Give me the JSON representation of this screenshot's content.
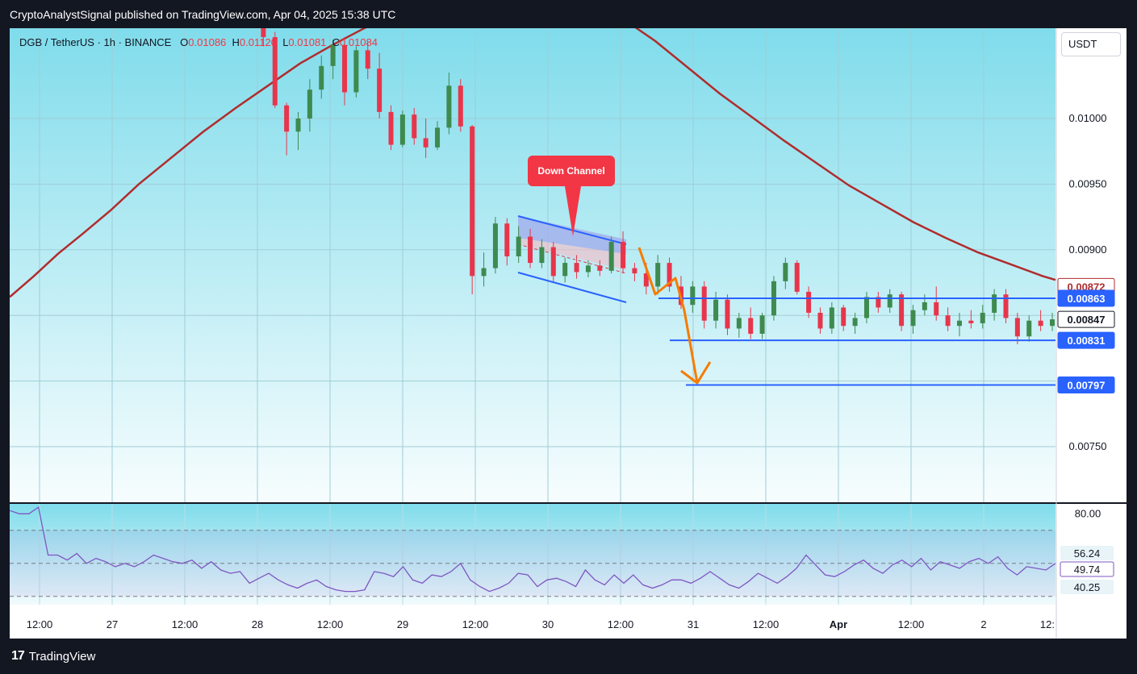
{
  "header": {
    "published_line": "CryptoAnalystSignal published on TradingView.com, Apr 04, 2025 15:38 UTC"
  },
  "legend": {
    "symbol": "DGB / TetherUS · 1h · BINANCE",
    "o_label": "O",
    "o_value": "0.01086",
    "h_label": "H",
    "h_value": "0.01120",
    "l_label": "L",
    "l_value": "0.01081",
    "c_label": "C",
    "c_value": "0.01084"
  },
  "currency_button": "USDT",
  "annotation": "Down Channel",
  "footer": {
    "logo_mark": "17",
    "logo_text": "TradingView"
  },
  "colors": {
    "bg_top": "#80dceb",
    "bg_bottom": "#ffffff",
    "up": "#3e8a4f",
    "down": "#e8354b",
    "ma": "#b02c2c",
    "level": "#2962ff",
    "arrow": "#f57c00",
    "rsi": "#7e57c2",
    "callout": "#f23645"
  },
  "chart_data": [
    {
      "type": "candlestick",
      "title": "DGB / TetherUS · 1h · BINANCE",
      "x_tick_labels": [
        "12:00",
        "27",
        "12:00",
        "28",
        "12:00",
        "29",
        "12:00",
        "30",
        "12:00",
        "31",
        "12:00",
        "Apr",
        "12:00",
        "2",
        "12:"
      ],
      "y_tick_labels": [
        "0.01000",
        "0.00950",
        "0.00900",
        "0.00750"
      ],
      "ylim": [
        0.0071,
        0.0108
      ],
      "grid": true,
      "ma_series": [
        [
          0,
          0.00864
        ],
        [
          30,
          0.0088
        ],
        [
          60,
          0.00897
        ],
        [
          90,
          0.00912
        ],
        [
          125,
          0.0093
        ],
        [
          160,
          0.0095
        ],
        [
          200,
          0.0097
        ],
        [
          240,
          0.0099
        ],
        [
          280,
          0.01008
        ],
        [
          320,
          0.01025
        ],
        [
          360,
          0.01042
        ],
        [
          400,
          0.01056
        ],
        [
          440,
          0.01069
        ],
        [
          480,
          0.01079
        ],
        [
          520,
          0.01087
        ],
        [
          560,
          0.01091
        ],
        [
          600,
          0.01094
        ],
        [
          640,
          0.01095
        ],
        [
          680,
          0.01092
        ],
        [
          720,
          0.01087
        ],
        [
          760,
          0.01076
        ],
        [
          800,
          0.01059
        ],
        [
          840,
          0.01039
        ],
        [
          880,
          0.01019
        ],
        [
          920,
          0.01001
        ],
        [
          960,
          0.00983
        ],
        [
          1000,
          0.00966
        ],
        [
          1040,
          0.00949
        ],
        [
          1080,
          0.00935
        ],
        [
          1120,
          0.00921
        ],
        [
          1160,
          0.00909
        ],
        [
          1200,
          0.00898
        ],
        [
          1240,
          0.00889
        ],
        [
          1280,
          0.0088
        ],
        [
          1296,
          0.00877
        ]
      ],
      "candles": [
        {
          "o": 0.01086,
          "h": 0.0112,
          "l": 0.01081,
          "c": 0.01084
        },
        {
          "o": 0.01084,
          "h": 0.01092,
          "l": 0.01055,
          "c": 0.01062
        },
        {
          "o": 0.01062,
          "h": 0.01066,
          "l": 0.01008,
          "c": 0.0101
        },
        {
          "o": 0.0101,
          "h": 0.01012,
          "l": 0.00972,
          "c": 0.0099
        },
        {
          "o": 0.0099,
          "h": 0.01005,
          "l": 0.00976,
          "c": 0.01
        },
        {
          "o": 0.01,
          "h": 0.0103,
          "l": 0.0099,
          "c": 0.01022
        },
        {
          "o": 0.01022,
          "h": 0.01048,
          "l": 0.01015,
          "c": 0.0104
        },
        {
          "o": 0.0104,
          "h": 0.0106,
          "l": 0.0103,
          "c": 0.01056
        },
        {
          "o": 0.01056,
          "h": 0.01062,
          "l": 0.0101,
          "c": 0.0102
        },
        {
          "o": 0.0102,
          "h": 0.01055,
          "l": 0.01016,
          "c": 0.01052
        },
        {
          "o": 0.01052,
          "h": 0.01058,
          "l": 0.0103,
          "c": 0.01038
        },
        {
          "o": 0.01038,
          "h": 0.0105,
          "l": 0.01,
          "c": 0.01005
        },
        {
          "o": 0.01005,
          "h": 0.0101,
          "l": 0.00976,
          "c": 0.0098
        },
        {
          "o": 0.0098,
          "h": 0.01006,
          "l": 0.00978,
          "c": 0.01003
        },
        {
          "o": 0.01003,
          "h": 0.01008,
          "l": 0.0098,
          "c": 0.00985
        },
        {
          "o": 0.00985,
          "h": 0.01,
          "l": 0.0097,
          "c": 0.00978
        },
        {
          "o": 0.00978,
          "h": 0.00998,
          "l": 0.00976,
          "c": 0.00993
        },
        {
          "o": 0.00993,
          "h": 0.01035,
          "l": 0.00988,
          "c": 0.01025
        },
        {
          "o": 0.01025,
          "h": 0.0103,
          "l": 0.0099,
          "c": 0.00994
        },
        {
          "o": 0.00994,
          "h": 0.00995,
          "l": 0.00866,
          "c": 0.0088
        },
        {
          "o": 0.0088,
          "h": 0.00898,
          "l": 0.00872,
          "c": 0.00886
        },
        {
          "o": 0.00886,
          "h": 0.00925,
          "l": 0.00882,
          "c": 0.0092
        },
        {
          "o": 0.0092,
          "h": 0.00924,
          "l": 0.00888,
          "c": 0.00895
        },
        {
          "o": 0.00895,
          "h": 0.00918,
          "l": 0.0089,
          "c": 0.0091
        },
        {
          "o": 0.0091,
          "h": 0.00916,
          "l": 0.00886,
          "c": 0.0089
        },
        {
          "o": 0.0089,
          "h": 0.00908,
          "l": 0.00886,
          "c": 0.00902
        },
        {
          "o": 0.00902,
          "h": 0.00906,
          "l": 0.00876,
          "c": 0.0088
        },
        {
          "o": 0.0088,
          "h": 0.00894,
          "l": 0.00875,
          "c": 0.0089
        },
        {
          "o": 0.0089,
          "h": 0.00896,
          "l": 0.00878,
          "c": 0.00883
        },
        {
          "o": 0.00883,
          "h": 0.00892,
          "l": 0.00879,
          "c": 0.00888
        },
        {
          "o": 0.00888,
          "h": 0.00892,
          "l": 0.0088,
          "c": 0.00884
        },
        {
          "o": 0.00884,
          "h": 0.0091,
          "l": 0.00882,
          "c": 0.00906
        },
        {
          "o": 0.00906,
          "h": 0.00914,
          "l": 0.00882,
          "c": 0.00886
        },
        {
          "o": 0.00886,
          "h": 0.0089,
          "l": 0.00876,
          "c": 0.00882
        },
        {
          "o": 0.00882,
          "h": 0.0089,
          "l": 0.00866,
          "c": 0.00872
        },
        {
          "o": 0.00872,
          "h": 0.00896,
          "l": 0.00866,
          "c": 0.0089
        },
        {
          "o": 0.0089,
          "h": 0.00894,
          "l": 0.00868,
          "c": 0.00872
        },
        {
          "o": 0.00872,
          "h": 0.0088,
          "l": 0.00855,
          "c": 0.00858
        },
        {
          "o": 0.00858,
          "h": 0.00876,
          "l": 0.00852,
          "c": 0.00872
        },
        {
          "o": 0.00872,
          "h": 0.00876,
          "l": 0.0084,
          "c": 0.00846
        },
        {
          "o": 0.00846,
          "h": 0.00868,
          "l": 0.0084,
          "c": 0.00862
        },
        {
          "o": 0.00862,
          "h": 0.00866,
          "l": 0.00835,
          "c": 0.0084
        },
        {
          "o": 0.0084,
          "h": 0.00852,
          "l": 0.00833,
          "c": 0.00848
        },
        {
          "o": 0.00848,
          "h": 0.00856,
          "l": 0.00832,
          "c": 0.00836
        },
        {
          "o": 0.00836,
          "h": 0.00852,
          "l": 0.00832,
          "c": 0.0085
        },
        {
          "o": 0.0085,
          "h": 0.0088,
          "l": 0.00846,
          "c": 0.00876
        },
        {
          "o": 0.00876,
          "h": 0.00894,
          "l": 0.0087,
          "c": 0.0089
        },
        {
          "o": 0.0089,
          "h": 0.00892,
          "l": 0.00866,
          "c": 0.00868
        },
        {
          "o": 0.00868,
          "h": 0.00872,
          "l": 0.00848,
          "c": 0.00852
        },
        {
          "o": 0.00852,
          "h": 0.00856,
          "l": 0.00836,
          "c": 0.0084
        },
        {
          "o": 0.0084,
          "h": 0.0086,
          "l": 0.00836,
          "c": 0.00856
        },
        {
          "o": 0.00856,
          "h": 0.00858,
          "l": 0.00838,
          "c": 0.00842
        },
        {
          "o": 0.00842,
          "h": 0.00852,
          "l": 0.00836,
          "c": 0.00848
        },
        {
          "o": 0.00848,
          "h": 0.00868,
          "l": 0.00844,
          "c": 0.00864
        },
        {
          "o": 0.00864,
          "h": 0.00868,
          "l": 0.00852,
          "c": 0.00856
        },
        {
          "o": 0.00856,
          "h": 0.0087,
          "l": 0.00852,
          "c": 0.00866
        },
        {
          "o": 0.00866,
          "h": 0.00868,
          "l": 0.00838,
          "c": 0.00842
        },
        {
          "o": 0.00842,
          "h": 0.00858,
          "l": 0.00836,
          "c": 0.00854
        },
        {
          "o": 0.00854,
          "h": 0.00866,
          "l": 0.0085,
          "c": 0.0086
        },
        {
          "o": 0.0086,
          "h": 0.00872,
          "l": 0.00846,
          "c": 0.0085
        },
        {
          "o": 0.0085,
          "h": 0.00856,
          "l": 0.00838,
          "c": 0.00842
        },
        {
          "o": 0.00842,
          "h": 0.00852,
          "l": 0.00834,
          "c": 0.00846
        },
        {
          "o": 0.00846,
          "h": 0.00854,
          "l": 0.0084,
          "c": 0.00844
        },
        {
          "o": 0.00844,
          "h": 0.00858,
          "l": 0.0084,
          "c": 0.00852
        },
        {
          "o": 0.00852,
          "h": 0.0087,
          "l": 0.00846,
          "c": 0.00866
        },
        {
          "o": 0.00866,
          "h": 0.0087,
          "l": 0.00844,
          "c": 0.00848
        },
        {
          "o": 0.00848,
          "h": 0.00852,
          "l": 0.00828,
          "c": 0.00834
        },
        {
          "o": 0.00834,
          "h": 0.0085,
          "l": 0.0083,
          "c": 0.00846
        },
        {
          "o": 0.00846,
          "h": 0.00854,
          "l": 0.00838,
          "c": 0.00842
        },
        {
          "o": 0.00842,
          "h": 0.00852,
          "l": 0.00838,
          "c": 0.00847
        }
      ],
      "levels": [
        {
          "label": "0.00872",
          "value": 0.00872,
          "tag_bg": "#ffffff",
          "tag_fg": "#b02c2c",
          "line": false
        },
        {
          "label": "0.00863",
          "value": 0.00863,
          "tag_bg": "#2962ff",
          "tag_fg": "#ffffff",
          "line": true
        },
        {
          "label": "0.00847",
          "value": 0.00847,
          "tag_bg": "#ffffff",
          "tag_fg": "#131722",
          "line": false
        },
        {
          "label": "0.00831",
          "value": 0.00831,
          "tag_bg": "#2962ff",
          "tag_fg": "#ffffff",
          "line": true
        },
        {
          "label": "0.00797",
          "value": 0.00797,
          "tag_bg": "#2962ff",
          "tag_fg": "#ffffff",
          "line": true
        }
      ]
    },
    {
      "type": "line",
      "title": "RSI",
      "ylim": [
        25,
        86
      ],
      "y_tick_labels": [
        "80.00"
      ],
      "bands": [
        70,
        50,
        30
      ],
      "value_tags": [
        "56.24",
        "49.74",
        "40.25"
      ],
      "values": [
        82,
        80,
        80,
        84,
        55,
        55,
        52,
        56,
        50,
        53,
        51,
        48,
        50,
        48,
        51,
        55,
        53,
        51,
        50,
        52,
        47,
        51,
        46,
        44,
        45,
        38,
        41,
        44,
        40,
        37,
        35,
        38,
        40,
        36,
        34,
        33,
        33,
        34,
        45,
        44,
        42,
        48,
        40,
        38,
        43,
        42,
        45,
        50,
        40,
        36,
        33,
        35,
        38,
        44,
        43,
        36,
        40,
        41,
        39,
        36,
        46,
        40,
        37,
        43,
        38,
        43,
        37,
        35,
        37,
        40,
        40,
        38,
        41,
        45,
        41,
        37,
        35,
        39,
        44,
        41,
        38,
        42,
        47,
        55,
        49,
        43,
        42,
        45,
        49,
        52,
        47,
        44,
        49,
        52,
        48,
        53,
        46,
        51,
        49,
        47,
        51,
        53,
        50,
        54,
        47,
        43,
        48,
        47,
        46,
        50
      ]
    }
  ]
}
